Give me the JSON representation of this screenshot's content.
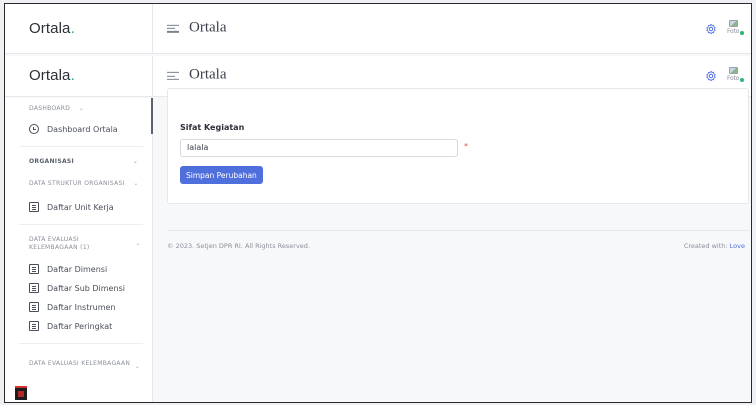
{
  "header": {
    "brand_name": "Ortala",
    "brand_dot": ".",
    "page_title": "Ortala",
    "avatar_alt": "Foto"
  },
  "sidebar": {
    "sections": [
      {
        "label": "DASHBOARD",
        "items": [
          {
            "label": "Dashboard Ortala",
            "icon": "clock-icon"
          }
        ]
      },
      {
        "label": "ORGANISASI"
      },
      {
        "label": "DATA STRUKTUR ORGANISASI",
        "items": [
          {
            "label": "Daftar Unit Kerja",
            "icon": "document-icon"
          }
        ]
      },
      {
        "label": "DATA EVALUASI KELEMBAGAAN (1)",
        "items": [
          {
            "label": "Daftar Dimensi",
            "icon": "document-icon"
          },
          {
            "label": "Daftar Sub Dimensi",
            "icon": "document-icon"
          },
          {
            "label": "Daftar Instrumen",
            "icon": "document-icon"
          },
          {
            "label": "Daftar Peringkat",
            "icon": "document-icon"
          }
        ]
      },
      {
        "label": "DATA EVALUASI KELEMBAGAAN"
      }
    ]
  },
  "form": {
    "field_label": "Sifat Kegiatan",
    "field_value": "lalala",
    "required_marker": "*",
    "submit_label": "Simpan Perubahan"
  },
  "footer": {
    "copyright": "© 2023. Setjen DPR RI. All Rights Reserved.",
    "created_prefix": "Created with: ",
    "created_link": "Love"
  },
  "colors": {
    "accent": "#4f6fdc",
    "brand_dot": "#2ab673",
    "required": "#e05252"
  }
}
